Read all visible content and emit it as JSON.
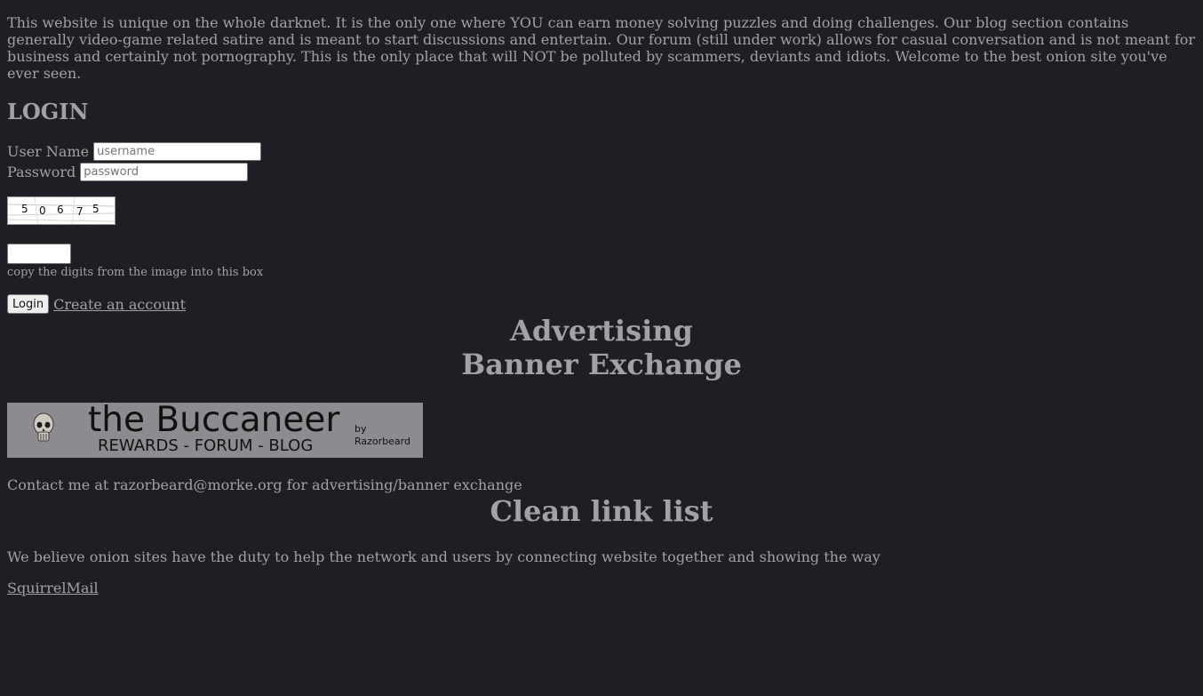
{
  "intro": {
    "text": "This website is unique on the whole darknet. It is the only one where YOU can earn money solving puzzles and doing challenges. Our blog section contains generally video-game related satire and is meant to start discussions and entertain. Our forum (still under work) allows for casual conversation and is not meant for business and certainly not pornography. This is the only place that will NOT be polluted by scammers, deviants and idiots. Welcome to the best onion site you've ever seen."
  },
  "login": {
    "heading": "LOGIN",
    "username_label": "User Name",
    "username_placeholder": "username",
    "password_label": "Password",
    "password_placeholder": "password",
    "captcha_digits": [
      "5",
      "0",
      "6",
      "7",
      "5"
    ],
    "captcha_hint": "copy the digits from the image into this box",
    "login_button": "Login",
    "create_account_link": "Create an account"
  },
  "advertising": {
    "heading": "Advertising"
  },
  "banner_exchange": {
    "heading": "Banner Exchange",
    "banner_title": "the Buccaneer",
    "banner_tagline": "REWARDS - FORUM - BLOG",
    "banner_by": "by Razorbeard",
    "contact_text": "Contact me at razorbeard@morke.org for advertising/banner exchange"
  },
  "links": {
    "heading": "Clean link list",
    "description": "We believe onion sites have the duty to help the network and users by connecting website together and showing the way",
    "items": [
      "SquirrelMail"
    ]
  },
  "colors": {
    "background": "#1f1e24",
    "text": "#a2a2a5",
    "banner_bg": "#8d8b8f"
  }
}
